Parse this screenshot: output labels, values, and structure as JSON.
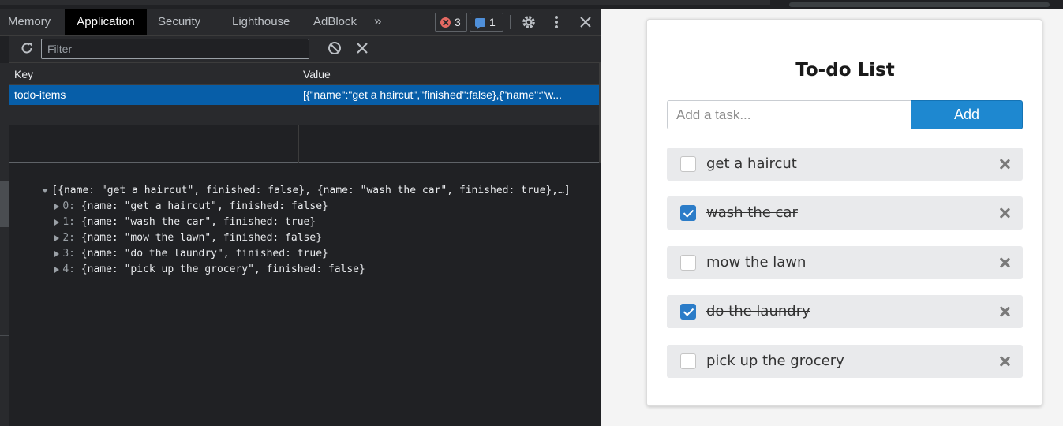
{
  "devtools": {
    "tabs": [
      {
        "label": "Memory",
        "active": false
      },
      {
        "label": "Application",
        "active": true
      },
      {
        "label": "Security",
        "active": false
      },
      {
        "label": "Lighthouse",
        "active": false
      },
      {
        "label": "AdBlock",
        "active": false
      }
    ],
    "overflow_label": "»",
    "error_count": "3",
    "message_count": "1",
    "icons": [
      "settings-gear-icon",
      "kebab-menu-icon",
      "close-icon",
      "refresh-icon",
      "clear-all-icon",
      "delete-icon"
    ],
    "toolbar": {
      "filter_placeholder": "Filter",
      "filter_value": ""
    },
    "table": {
      "headers": {
        "key": "Key",
        "value": "Value"
      },
      "rows": [
        {
          "key": "todo-items",
          "value": "[{\"name\":\"get a haircut\",\"finished\":false},{\"name\":\"w..."
        }
      ]
    },
    "preview": {
      "summary": "[{name: \"get a haircut\", finished: false}, {name: \"wash the car\", finished: true},…]",
      "items": [
        {
          "index": "0:",
          "text": "{name: \"get a haircut\", finished: false}"
        },
        {
          "index": "1:",
          "text": "{name: \"wash the car\", finished: true}"
        },
        {
          "index": "2:",
          "text": "{name: \"mow the lawn\", finished: false}"
        },
        {
          "index": "3:",
          "text": "{name: \"do the laundry\", finished: true}"
        },
        {
          "index": "4:",
          "text": "{name: \"pick up the grocery\", finished: false}"
        }
      ]
    },
    "colors": {
      "background": "#202124",
      "selected_row": "#075ea8",
      "active_tab": "#000000"
    }
  },
  "app": {
    "title": "To-do List",
    "input": {
      "placeholder": "Add a task...",
      "value": ""
    },
    "add_label": "Add",
    "todos": [
      {
        "name": "get a haircut",
        "finished": false
      },
      {
        "name": "wash the car",
        "finished": true
      },
      {
        "name": "mow the lawn",
        "finished": false
      },
      {
        "name": "do the laundry",
        "finished": true
      },
      {
        "name": "pick up the grocery",
        "finished": false
      }
    ],
    "colors": {
      "accent": "#1e88d0",
      "item_background": "#e9eaec"
    }
  }
}
